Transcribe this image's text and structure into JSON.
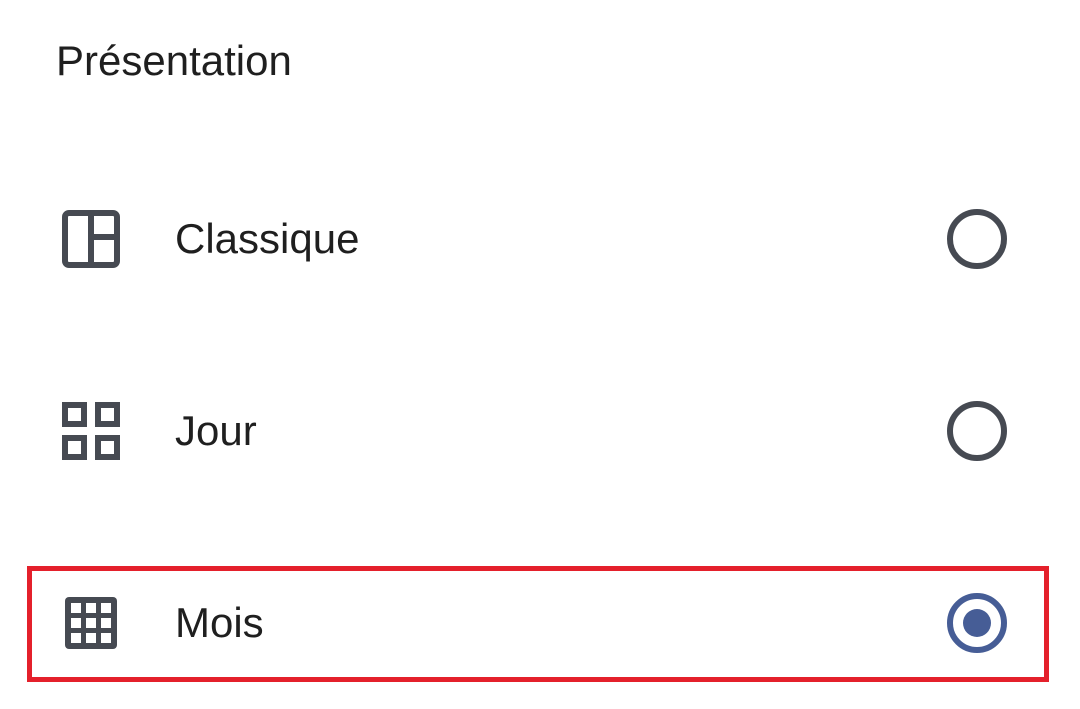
{
  "title": "Présentation",
  "options": [
    {
      "label": "Classique",
      "icon": "panel-layout-icon",
      "selected": false
    },
    {
      "label": "Jour",
      "icon": "four-squares-icon",
      "selected": false
    },
    {
      "label": "Mois",
      "icon": "grid-icon",
      "selected": true
    }
  ],
  "colors": {
    "text": "#1f1f1f",
    "icon": "#464a52",
    "radio_selected": "#465d96",
    "highlight": "#e4202b"
  }
}
